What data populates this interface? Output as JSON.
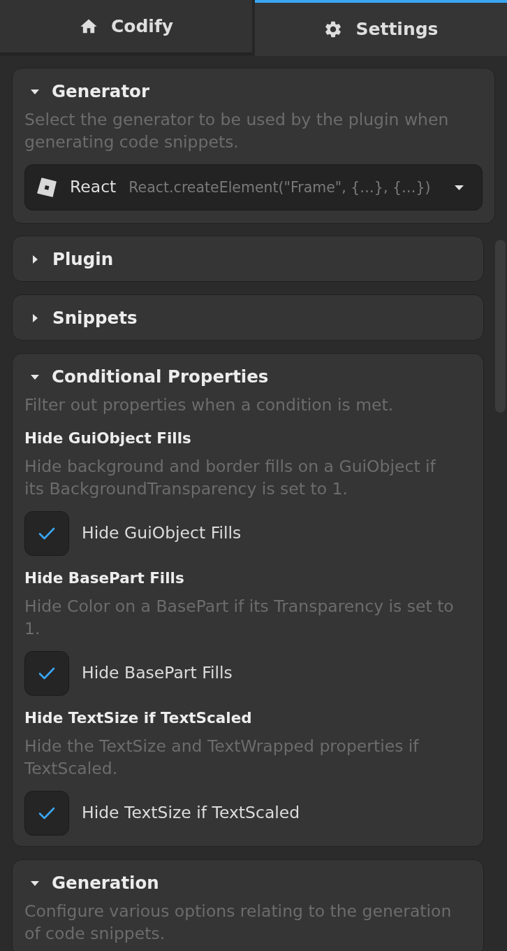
{
  "tabs": [
    {
      "label": "Codify",
      "selected": false
    },
    {
      "label": "Settings",
      "selected": true
    }
  ],
  "generator": {
    "title": "Generator",
    "expanded": true,
    "description": "Select the generator to be used by the plugin when generating code snippets.",
    "select": {
      "value": "React",
      "preview": "React.createElement(\"Frame\", {…}, {…})"
    }
  },
  "sections": [
    {
      "title": "Plugin",
      "expanded": false
    },
    {
      "title": "Snippets",
      "expanded": false
    },
    {
      "title": "Conditional Properties",
      "expanded": true,
      "description": "Filter out properties when a condition is met.",
      "options": [
        {
          "title": "Hide GuiObject Fills",
          "description": "Hide background and border fills on a GuiObject if its BackgroundTransparency is set to 1.",
          "label": "Hide GuiObject Fills",
          "checked": true
        },
        {
          "title": "Hide BasePart Fills",
          "description": "Hide Color on a BasePart if its Transparency is set to 1.",
          "label": "Hide BasePart Fills",
          "checked": true
        },
        {
          "title": "Hide TextSize if TextScaled",
          "description": "Hide the TextSize and TextWrapped properties if TextScaled.",
          "label": "Hide TextSize if TextScaled",
          "checked": true
        }
      ]
    },
    {
      "title": "Generation",
      "expanded": true,
      "description": "Configure various options relating to the generation of code snippets."
    }
  ]
}
